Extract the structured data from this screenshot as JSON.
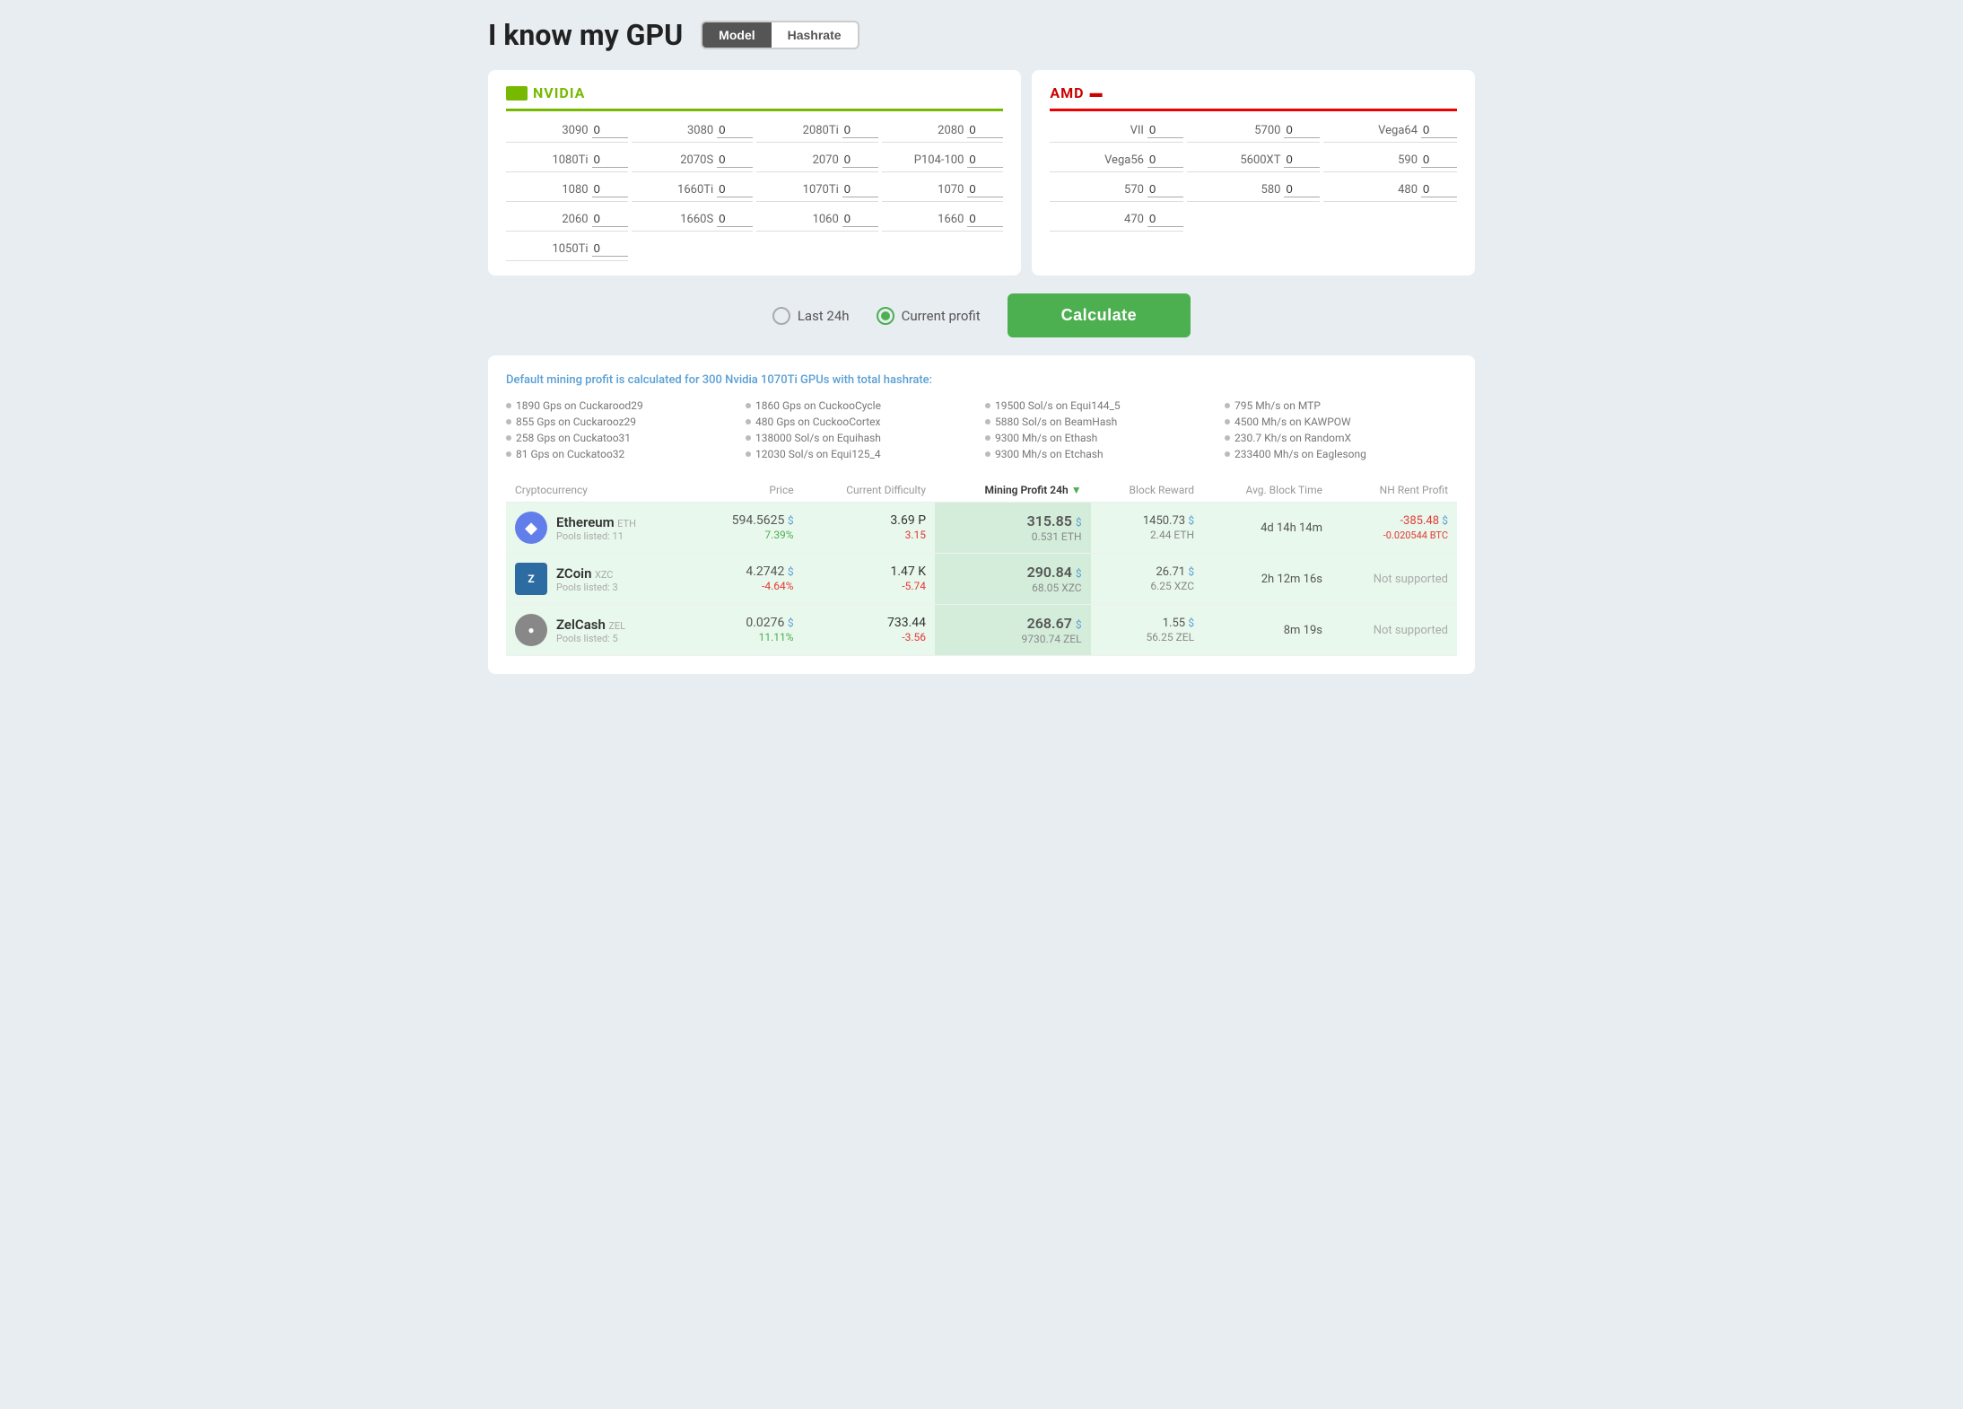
{
  "header": {
    "title": "I know my GPU",
    "toggle": {
      "model_label": "Model",
      "hashrate_label": "Hashrate",
      "active": "Model"
    }
  },
  "nvidia": {
    "brand": "NVIDIA",
    "gpus": [
      {
        "label": "3090",
        "value": "0"
      },
      {
        "label": "3080",
        "value": "0"
      },
      {
        "label": "2080Ti",
        "value": "0"
      },
      {
        "label": "2080",
        "value": "0"
      },
      {
        "label": "1080Ti",
        "value": "0"
      },
      {
        "label": "2070S",
        "value": "0"
      },
      {
        "label": "2070",
        "value": "0"
      },
      {
        "label": "P104-100",
        "value": "0"
      },
      {
        "label": "1080",
        "value": "0"
      },
      {
        "label": "1660Ti",
        "value": "0"
      },
      {
        "label": "1070Ti",
        "value": "0"
      },
      {
        "label": "1070",
        "value": "0"
      },
      {
        "label": "2060",
        "value": "0"
      },
      {
        "label": "1660S",
        "value": "0"
      },
      {
        "label": "1060",
        "value": "0"
      },
      {
        "label": "1660",
        "value": "0"
      },
      {
        "label": "1050Ti",
        "value": "0"
      }
    ]
  },
  "amd": {
    "brand": "AMD",
    "gpus": [
      {
        "label": "VII",
        "value": "0"
      },
      {
        "label": "5700",
        "value": "0"
      },
      {
        "label": "Vega64",
        "value": "0"
      },
      {
        "label": "Vega56",
        "value": "0"
      },
      {
        "label": "5600XT",
        "value": "0"
      },
      {
        "label": "590",
        "value": "0"
      },
      {
        "label": "570",
        "value": "0"
      },
      {
        "label": "580",
        "value": "0"
      },
      {
        "label": "480",
        "value": "0"
      },
      {
        "label": "470",
        "value": "0"
      }
    ]
  },
  "controls": {
    "last24h_label": "Last 24h",
    "current_profit_label": "Current profit",
    "calculate_label": "Calculate",
    "selected": "current_profit"
  },
  "results": {
    "default_info": "Default mining profit is calculated for 300 Nvidia 1070Ti GPUs with total hashrate:",
    "hashrates": [
      "1890 Gps on Cuckarood29",
      "1860 Gps on CuckooCycle",
      "19500 Sol/s on Equi144_5",
      "795 Mh/s on MTP",
      "855 Gps on Cuckarooz29",
      "480 Gps on CuckooCortex",
      "5880 Sol/s on BeamHash",
      "4500 Mh/s on KAWPOW",
      "258 Gps on Cuckatoo31",
      "138000 Sol/s on Equihash",
      "9300 Mh/s on Ethash",
      "230.7 Kh/s on RandomX",
      "81 Gps on Cuckatoo32",
      "12030 Sol/s on Equi125_4",
      "9300 Mh/s on Etchash",
      "233400 Mh/s on Eaglesong"
    ]
  },
  "table": {
    "headers": [
      {
        "key": "cryptocurrency",
        "label": "Cryptocurrency",
        "align": "left"
      },
      {
        "key": "price",
        "label": "Price",
        "align": "right"
      },
      {
        "key": "difficulty",
        "label": "Current Difficulty",
        "align": "right"
      },
      {
        "key": "profit",
        "label": "Mining Profit 24h",
        "align": "right",
        "active": true
      },
      {
        "key": "block_reward",
        "label": "Block Reward",
        "align": "right"
      },
      {
        "key": "block_time",
        "label": "Avg. Block Time",
        "align": "right"
      },
      {
        "key": "nh_profit",
        "label": "NH Rent Profit",
        "align": "right"
      }
    ],
    "rows": [
      {
        "icon": "ETH",
        "name": "Ethereum",
        "ticker": "ETH",
        "pools": "Pools listed: 11",
        "price": "594.5625",
        "price_unit": "$",
        "change": "7.39%",
        "change_positive": true,
        "difficulty": "3.69 P",
        "difficulty_change": "3.15",
        "difficulty_change_positive": false,
        "profit": "315.85",
        "profit_unit": "$",
        "profit_sub": "0.531 ETH",
        "block_reward": "1450.73",
        "block_reward_unit": "$",
        "block_reward_sub": "2.44 ETH",
        "block_time": "4d 14h 14m",
        "nh_profit": "-385.48",
        "nh_profit_unit": "$",
        "nh_profit_sub": "-0.020544 BTC",
        "nh_supported": true
      },
      {
        "icon": "ZXC",
        "name": "ZCoin",
        "ticker": "XZC",
        "pools": "Pools listed: 3",
        "price": "4.2742",
        "price_unit": "$",
        "change": "-4.64%",
        "change_positive": false,
        "difficulty": "1.47 K",
        "difficulty_change": "-5.74",
        "difficulty_change_positive": false,
        "profit": "290.84",
        "profit_unit": "$",
        "profit_sub": "68.05 XZC",
        "block_reward": "26.71",
        "block_reward_unit": "$",
        "block_reward_sub": "6.25 XZC",
        "block_time": "2h 12m 16s",
        "nh_profit": null,
        "nh_supported": false,
        "nh_label": "Not supported"
      },
      {
        "icon": "ZEL",
        "name": "ZelCash",
        "ticker": "ZEL",
        "pools": "Pools listed: 5",
        "price": "0.0276",
        "price_unit": "$",
        "change": "11.11%",
        "change_positive": true,
        "difficulty": "733.44",
        "difficulty_change": "-3.56",
        "difficulty_change_positive": false,
        "profit": "268.67",
        "profit_unit": "$",
        "profit_sub": "9730.74 ZEL",
        "block_reward": "1.55",
        "block_reward_unit": "$",
        "block_reward_sub": "56.25 ZEL",
        "block_time": "8m 19s",
        "nh_profit": null,
        "nh_supported": false,
        "nh_label": "Not supported"
      }
    ]
  }
}
